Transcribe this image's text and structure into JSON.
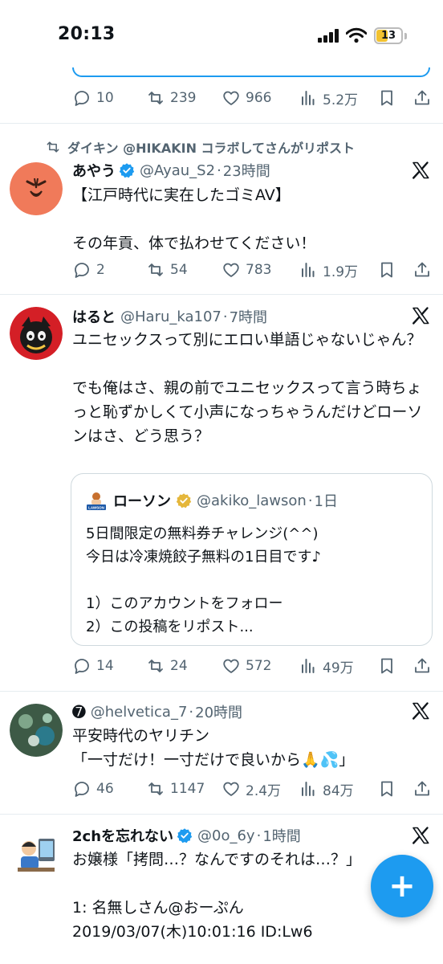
{
  "status_bar": {
    "time": "20:13",
    "battery": "13"
  },
  "colors": {
    "accent": "#1d9bf0",
    "secondary_text": "#536471",
    "verified": "#1d9bf0",
    "gold_verified": "#e5b73b"
  },
  "prev_tweet": {
    "actions": {
      "replies": "10",
      "reposts": "239",
      "likes": "966",
      "views": "5.2万"
    }
  },
  "tweets": [
    {
      "repost_banner": "ダイキン @HIKAKIN コラボしてさんがリポスト",
      "name": "あやう",
      "handle": "@Ayau_S2",
      "time": "23時間",
      "text": "【江戸時代に実在したゴミAV】\n\nその年貢、体で払わせてください！",
      "actions": {
        "replies": "2",
        "reposts": "54",
        "likes": "783",
        "views": "1.9万"
      }
    },
    {
      "name": "はると",
      "handle": "@Haru_ka107",
      "time": "7時間",
      "text": "ユニセックスって別にエロい単語じゃないじゃん？\n\nでも俺はさ、親の前でユニセックスって言う時ちょっと恥ずかしくて小声になっちゃうんだけどローソンはさ、どう思う？",
      "quote": {
        "name": "ローソン",
        "handle": "@akiko_lawson",
        "time": "1日",
        "avatar_text": "LAWSON",
        "text": "5日間限定の無料券チャレンジ(^^)\n今日は冷凍焼餃子無料の1日目です♪\n\n1）このアカウントをフォロー\n2）この投稿をリポスト..."
      },
      "actions": {
        "replies": "14",
        "reposts": "24",
        "likes": "572",
        "views": "49万"
      }
    },
    {
      "name": "➐",
      "handle": "@helvetica_7",
      "time": "20時間",
      "text": "平安時代のヤリチン\n「一寸だけ！一寸だけで良いから🙏💦」",
      "actions": {
        "replies": "46",
        "reposts": "1147",
        "likes": "2.4万",
        "views": "84万"
      }
    },
    {
      "name": "2chを忘れない",
      "handle": "@0o_6y",
      "time": "1時間",
      "text": "お嬢様「拷問…？なんですのそれは…？」\n\n1: 名無しさん@おーぷん\n2019/03/07(木)10:01:16 ID:Lw6"
    }
  ],
  "icons": {
    "reply": "reply-icon",
    "repost": "repost-icon",
    "like": "heart-icon",
    "views": "views-icon",
    "bookmark": "bookmark-icon",
    "share": "share-icon",
    "x": "x-logo-icon",
    "compose": "plus-icon"
  },
  "fab": {
    "label": "+"
  }
}
